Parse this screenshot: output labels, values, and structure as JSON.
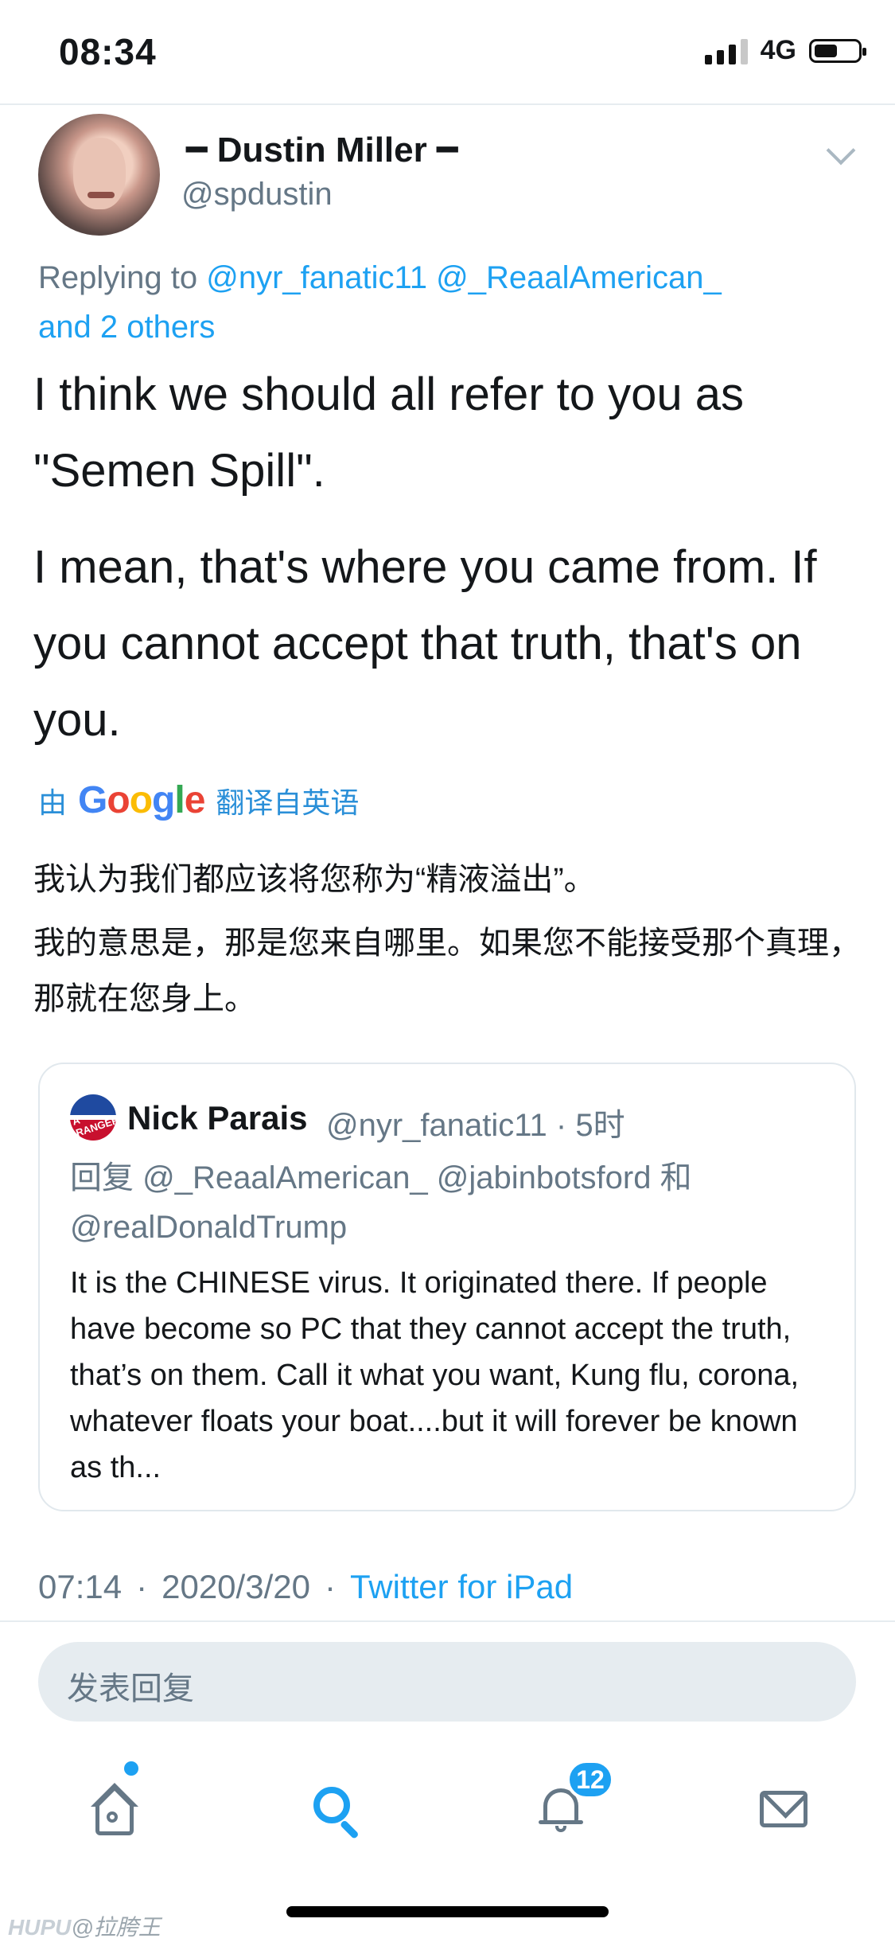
{
  "status_bar": {
    "time": "08:34",
    "network": "4G"
  },
  "author": {
    "name": "━ Dustin Miller ━",
    "handle": "@spdustin"
  },
  "replying": {
    "prefix": "Replying to ",
    "handles": "@nyr_fanatic11 @_ReaalAmerican_",
    "others": "and 2 others"
  },
  "tweet": {
    "p1": "I think we should all refer to you as \"Semen Spill\".",
    "p2": "I mean, that's where you came from. If you cannot accept that truth, that's on you."
  },
  "translation": {
    "prefix": "由",
    "google": "Google",
    "suffix": "翻译自英语",
    "p1": "我认为我们都应该将您称为“精液溢出”。",
    "p2": "我的意思是，那是您来自哪里。如果您不能接受那个真理，那就在您身上。"
  },
  "quoted": {
    "avatar_text": "A RANGER",
    "name": "Nick Parais",
    "meta": "@nyr_fanatic11 · 5时",
    "reply_prefix": "回复 ",
    "reply_handles_1": "@_ReaalAmerican_ @jabinbotsford",
    "reply_and": " 和",
    "reply_handles_2": "@realDonaldTrump",
    "text": "It is the CHINESE virus. It originated there. If people have become so PC that they cannot accept the truth, that’s on them. Call it what you want, Kung flu, corona, whatever floats your boat....but it will forever be known as th..."
  },
  "footer": {
    "time": "07:14",
    "sep": "·",
    "date": "2020/3/20",
    "source": "Twitter for iPad"
  },
  "reply_box": {
    "placeholder": "发表回复"
  },
  "tabs": [
    {
      "icon": "home-icon"
    },
    {
      "icon": "search-icon"
    },
    {
      "icon": "bell-icon",
      "badge": "12"
    },
    {
      "icon": "mail-icon"
    }
  ],
  "watermark": {
    "brand": "HUPU",
    "user": "@拉胯王"
  },
  "colors": {
    "link": "#1da1f2",
    "muted": "#657786",
    "text": "#14171a"
  }
}
